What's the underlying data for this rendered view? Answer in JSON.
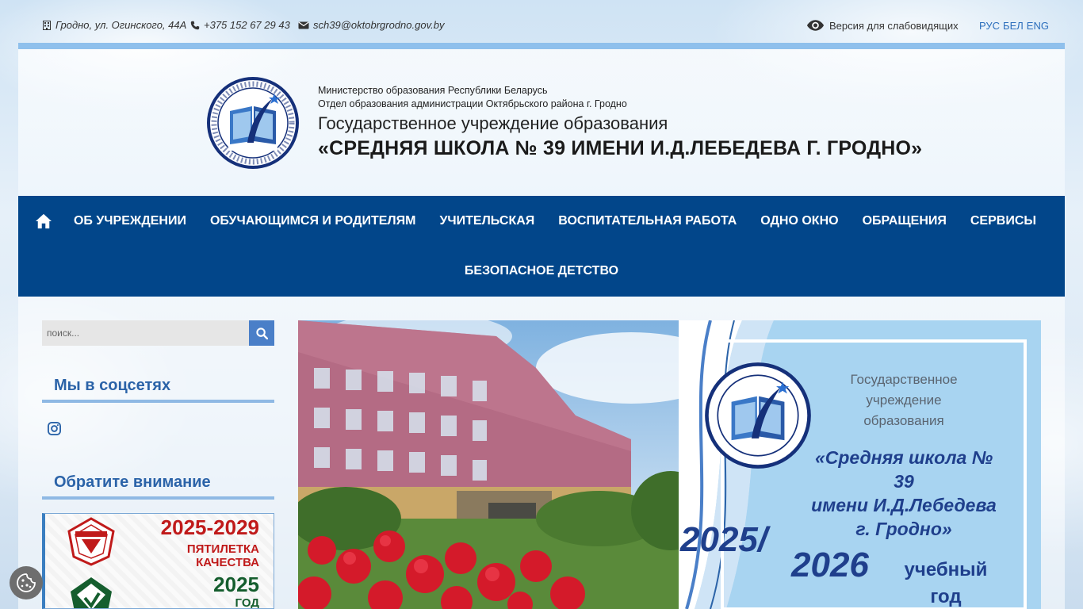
{
  "topbar": {
    "address": "Гродно, ул. Огинского, 44А",
    "phone": "+375 152 67 29 43",
    "email": "sch39@oktobrgrodno.gov.by",
    "vision_label": "Версия для слабовидящих",
    "languages": [
      "РУС",
      "БЕЛ",
      "ENG"
    ]
  },
  "header": {
    "ministry": "Министерство образования Республики Беларусь",
    "department": "Отдел образования администрации Октябрьского района г. Гродно",
    "institution_type": "Государственное учреждение образования",
    "school_name": "«СРЕДНЯЯ ШКОЛА № 39 ИМЕНИ И.Д.ЛЕБЕДЕВА Г. ГРОДНО»"
  },
  "nav": {
    "items_row1": [
      "ОБ УЧРЕЖДЕНИИ",
      "ОБУЧАЮЩИМСЯ И РОДИТЕЛЯМ",
      "УЧИТЕЛЬСКАЯ",
      "ВОСПИТАТЕЛЬНАЯ РАБОТА",
      "ОДНО ОКНО",
      "ОБРАЩЕНИЯ",
      "СЕРВИСЫ"
    ],
    "items_row2": [
      "БЕЗОПАСНОЕ ДЕТСТВО"
    ]
  },
  "sidebar": {
    "search_placeholder": "поиск...",
    "social_title": "Мы в соцсетях",
    "attention_title": "Обратите внимание",
    "banner": {
      "years": "2025-2029",
      "line1": "ПЯТИЛЕТКА",
      "line2": "КАЧЕСТВА",
      "year2": "2025",
      "line3": "ГОД"
    }
  },
  "hero": {
    "institution_type": "Государственное учреждение образования",
    "name_line1": "«Средняя школа № 39",
    "name_line2": "имени И.Д.Лебедева",
    "name_line3": "г. Гродно»",
    "year1": "2025/",
    "year2": "2026",
    "year_label_1": "учебный",
    "year_label_2": "год"
  },
  "colors": {
    "nav_bg": "#02468a",
    "accent": "#2b63a8",
    "strip": "#8fc0ec"
  }
}
